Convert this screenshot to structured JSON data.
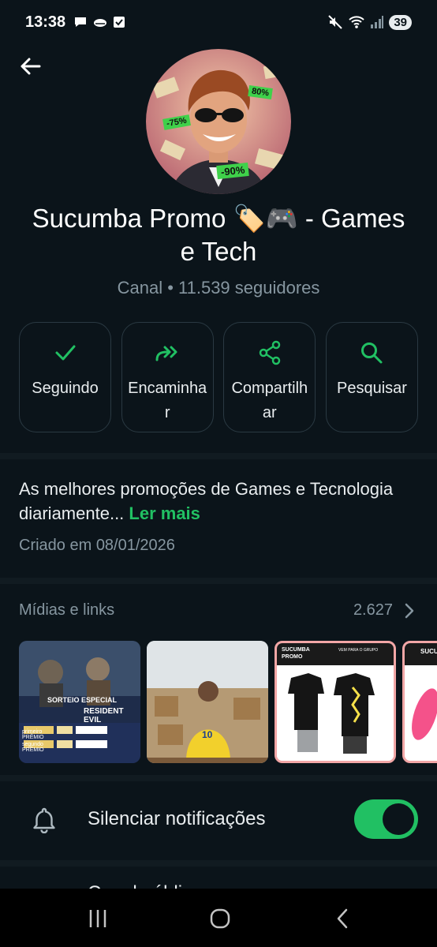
{
  "status_bar": {
    "time": "13:38",
    "battery": "39",
    "left_icons": [
      "chat-bubble-icon",
      "cloud-icon",
      "checkbox-icon"
    ],
    "right_icons": [
      "mute-icon",
      "wifi-icon",
      "signal-icon"
    ]
  },
  "header": {
    "back_icon": "arrow-left-icon"
  },
  "channel": {
    "title": "Sucumba Promo 🏷️🎮  - Games e Tech",
    "subtitle": "Canal • 11.539 seguidores",
    "avatar_badges": [
      "80%",
      "-75%",
      "-90%"
    ]
  },
  "actions": [
    {
      "label": "Seguindo",
      "icon": "check-icon"
    },
    {
      "label": "Encaminhar",
      "icon": "forward-icon"
    },
    {
      "label": "Compartilhar",
      "icon": "share-icon"
    },
    {
      "label": "Pesquisar",
      "icon": "search-icon"
    }
  ],
  "description": {
    "text": "As melhores promoções de Games e Tecnologia diariamente... ",
    "read_more": "Ler mais",
    "created": "Criado em 08/01/2026"
  },
  "media": {
    "title": "Mídias e links",
    "count": "2.627",
    "thumbs": [
      {
        "lines": [
          "SORTEIO ESPECIAL",
          "RESIDENT EVIL",
          "primeiro PRÊMIO",
          "segundo PRÊMIO"
        ]
      },
      {
        "lines": [
          "10"
        ]
      },
      {
        "lines": [
          "SUCUMBA PROMO",
          "VEM PARA O GRUPO"
        ]
      },
      {
        "lines": [
          "SUCUMBA"
        ]
      }
    ]
  },
  "mute": {
    "label": "Silenciar notificações",
    "enabled": true
  },
  "partial_row": {
    "label": "Canal público"
  },
  "colors": {
    "background": "#0b141a",
    "accent": "#21c063",
    "muted_text": "#8696a0",
    "border": "#2a3942"
  }
}
